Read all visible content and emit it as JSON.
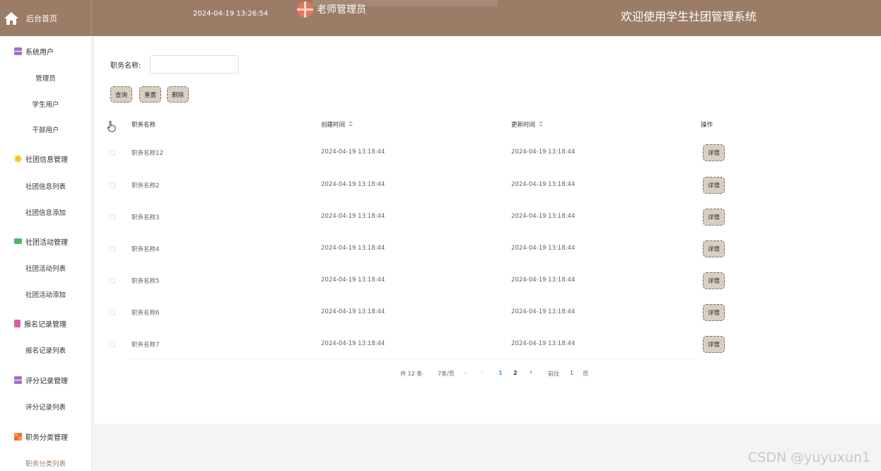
{
  "header": {
    "home_label": "后台首页",
    "datetime": "2024-04-19 13:26:54",
    "user_name": "老师管理员",
    "welcome": "欢迎使用学生社团管理系统"
  },
  "sidebar": {
    "groups": [
      {
        "label": "系统用户",
        "icon": "user-stack-icon",
        "items": [
          "管理员",
          "学生用户",
          "干部用户"
        ]
      },
      {
        "label": "社团信息管理",
        "icon": "coin-icon",
        "items": [
          "社团信息列表",
          "社团信息添加"
        ]
      },
      {
        "label": "社团活动管理",
        "icon": "chat-icon",
        "items": [
          "社团活动列表",
          "社团活动添加"
        ]
      },
      {
        "label": "报名记录管理",
        "icon": "document-icon",
        "items": [
          "报名记录列表"
        ]
      },
      {
        "label": "评分记录管理",
        "icon": "user-stack-icon",
        "items": [
          "评分记录列表"
        ]
      },
      {
        "label": "职务分类管理",
        "icon": "grid-icon",
        "items": [
          "职务分类列表"
        ]
      }
    ],
    "active_item": "职务分类列表"
  },
  "search": {
    "label": "职务名称:",
    "value": "",
    "placeholder": ""
  },
  "buttons": {
    "query": "查询",
    "reset": "重置",
    "delete": "删除"
  },
  "table": {
    "columns": [
      "职务名称",
      "创建时间",
      "更新时间",
      "操作"
    ],
    "rows": [
      {
        "name": "职务名称12",
        "created": "2024-04-19 13:18:44",
        "updated": "2024-04-19 13:18:44"
      },
      {
        "name": "职务名称2",
        "created": "2024-04-19 13:18:44",
        "updated": "2024-04-19 13:18:44"
      },
      {
        "name": "职务名称3",
        "created": "2024-04-19 13:18:44",
        "updated": "2024-04-19 13:18:44"
      },
      {
        "name": "职务名称4",
        "created": "2024-04-19 13:18:44",
        "updated": "2024-04-19 13:18:44"
      },
      {
        "name": "职务名称5",
        "created": "2024-04-19 13:18:44",
        "updated": "2024-04-19 13:18:44"
      },
      {
        "name": "职务名称6",
        "created": "2024-04-19 13:18:44",
        "updated": "2024-04-19 13:18:44"
      },
      {
        "name": "职务名称7",
        "created": "2024-04-19 13:18:44",
        "updated": "2024-04-19 13:18:44"
      }
    ],
    "detail_label": "详情"
  },
  "pagination": {
    "total": "共 12 条",
    "page_size": "7条/页",
    "pages": [
      "1",
      "2"
    ],
    "current_page": "1",
    "goto_label": "前往",
    "goto_value": "1",
    "page_unit": "页"
  },
  "watermark": "CSDN @yuyuxun1",
  "colors": {
    "header_bg": "#9b7c67",
    "button_bg": "#d8cfc3",
    "active_page": "#409eff"
  }
}
